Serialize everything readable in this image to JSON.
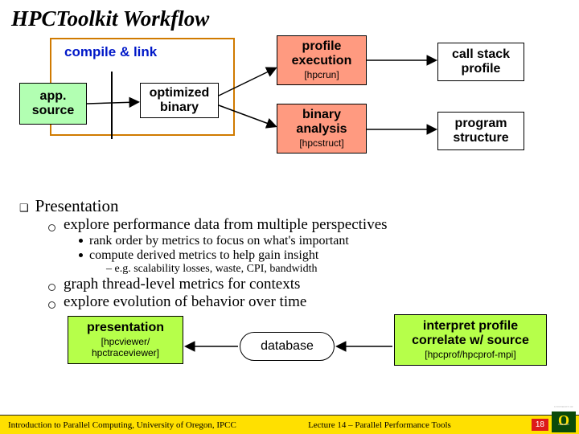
{
  "title": "HPCToolkit Workflow",
  "top": {
    "compile_link": "compile & link",
    "app_source": "app. source",
    "optimized_binary": "optimized binary",
    "profile_execution": "profile execution",
    "hpcrun": "[hpcrun]",
    "binary_analysis": "binary analysis",
    "hpcstruct": "[hpcstruct]",
    "call_stack_profile": "call stack profile",
    "program_structure": "program structure"
  },
  "bullets": {
    "presentation_hdr": "Presentation",
    "explore": "explore performance data from multiple perspectives",
    "rank": "rank order by metrics to focus on what's important",
    "derived": "compute derived metrics to help gain insight",
    "eg": "– e.g. scalability losses, waste, CPI, bandwidth",
    "graph": "graph thread-level metrics for contexts",
    "evolution": "explore evolution of behavior over time"
  },
  "bottom": {
    "presentation": "presentation",
    "hpcviewer": "[hpcviewer/ hpctraceviewer]",
    "database": "database",
    "interpret_l1": "interpret profile",
    "interpret_l2": "correlate w/ source",
    "hpcprof": "[hpcprof/hpcprof-mpi]"
  },
  "footer": {
    "left": "Introduction to Parallel Computing, University of Oregon, IPCC",
    "mid": "Lecture 14 – Parallel Performance Tools",
    "page": "18",
    "logo": "O"
  }
}
